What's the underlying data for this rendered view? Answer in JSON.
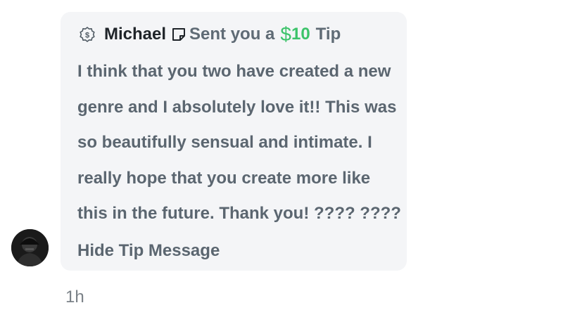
{
  "message": {
    "sender": "Michael",
    "tip_text": "Sent you a",
    "tip_currency": "$",
    "tip_amount": "10",
    "tip_suffix": "Tip",
    "lines": [
      "I think that you two have created a new",
      "genre and I absolutely love it!! This was",
      "so beautifully sensual and intimate. I",
      "really hope that you create more like",
      "this in the future. Thank you! ???? ????"
    ],
    "hide_label": "Hide Tip Message",
    "timestamp": "1h"
  },
  "icons": {
    "tip": "dollar-badge-icon",
    "note": "note-icon",
    "avatar": "user-avatar"
  },
  "colors": {
    "bubble_bg": "#f4f5f7",
    "tip_green": "#3cc36a",
    "text_gray": "#5b6670",
    "sender_dark": "#1f2429"
  }
}
